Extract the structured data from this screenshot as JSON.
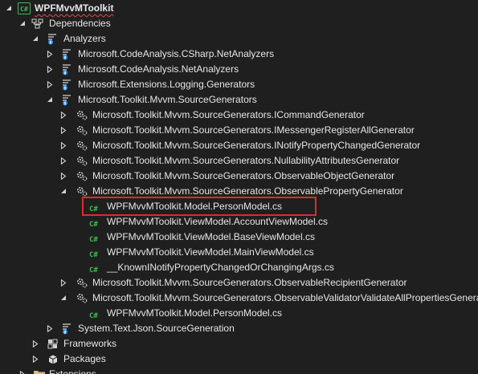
{
  "tree": [
    {
      "label": "WPFMvvMToolkit",
      "icon": "csharp-project-icon",
      "state": "expanded"
    },
    {
      "label": "Dependencies",
      "icon": "dependencies-icon",
      "state": "expanded"
    },
    {
      "label": "Analyzers",
      "icon": "analyzers-folder-icon",
      "state": "expanded"
    },
    {
      "label": "Microsoft.CodeAnalysis.CSharp.NetAnalyzers",
      "icon": "analyzer-package-icon",
      "state": "collapsed"
    },
    {
      "label": "Microsoft.CodeAnalysis.NetAnalyzers",
      "icon": "analyzer-package-icon",
      "state": "collapsed"
    },
    {
      "label": "Microsoft.Extensions.Logging.Generators",
      "icon": "analyzer-package-icon",
      "state": "collapsed"
    },
    {
      "label": "Microsoft.Toolkit.Mvvm.SourceGenerators",
      "icon": "analyzer-package-icon",
      "state": "expanded"
    },
    {
      "label": "Microsoft.Toolkit.Mvvm.SourceGenerators.ICommandGenerator",
      "icon": "source-generator-icon",
      "state": "collapsed"
    },
    {
      "label": "Microsoft.Toolkit.Mvvm.SourceGenerators.IMessengerRegisterAllGenerator",
      "icon": "source-generator-icon",
      "state": "collapsed"
    },
    {
      "label": "Microsoft.Toolkit.Mvvm.SourceGenerators.INotifyPropertyChangedGenerator",
      "icon": "source-generator-icon",
      "state": "collapsed"
    },
    {
      "label": "Microsoft.Toolkit.Mvvm.SourceGenerators.NullabilityAttributesGenerator",
      "icon": "source-generator-icon",
      "state": "collapsed"
    },
    {
      "label": "Microsoft.Toolkit.Mvvm.SourceGenerators.ObservableObjectGenerator",
      "icon": "source-generator-icon",
      "state": "collapsed"
    },
    {
      "label": "Microsoft.Toolkit.Mvvm.SourceGenerators.ObservablePropertyGenerator",
      "icon": "source-generator-icon",
      "state": "expanded"
    },
    {
      "label": "WPFMvvMToolkit.Model.PersonModel.cs",
      "icon": "csharp-file-icon",
      "state": "leaf",
      "selected": true
    },
    {
      "label": "WPFMvvMToolkit.ViewModel.AccountViewModel.cs",
      "icon": "csharp-file-icon",
      "state": "leaf"
    },
    {
      "label": "WPFMvvMToolkit.ViewModel.BaseViewModel.cs",
      "icon": "csharp-file-icon",
      "state": "leaf"
    },
    {
      "label": "WPFMvvMToolkit.ViewModel.MainViewModel.cs",
      "icon": "csharp-file-icon",
      "state": "leaf"
    },
    {
      "label": "__KnownINotifyPropertyChangedOrChangingArgs.cs",
      "icon": "csharp-file-icon",
      "state": "leaf"
    },
    {
      "label": "Microsoft.Toolkit.Mvvm.SourceGenerators.ObservableRecipientGenerator",
      "icon": "source-generator-icon",
      "state": "collapsed"
    },
    {
      "label": "Microsoft.Toolkit.Mvvm.SourceGenerators.ObservableValidatorValidateAllPropertiesGenerator",
      "icon": "source-generator-icon",
      "state": "expanded"
    },
    {
      "label": "WPFMvvMToolkit.Model.PersonModel.cs",
      "icon": "csharp-file-icon",
      "state": "leaf"
    },
    {
      "label": "System.Text.Json.SourceGeneration",
      "icon": "analyzer-package-icon",
      "state": "collapsed"
    },
    {
      "label": "Frameworks",
      "icon": "frameworks-icon",
      "state": "collapsed"
    },
    {
      "label": "Packages",
      "icon": "packages-icon",
      "state": "collapsed"
    },
    {
      "label": "Extensions",
      "icon": "folder-icon",
      "state": "collapsed"
    }
  ],
  "colors": {
    "background": "#1f1f1f",
    "text": "#e6e6e6",
    "csharp_green": "#3fb950",
    "highlight_border": "#e12a2a",
    "analyzer_blue": "#2f8fe8",
    "folder_yellow": "#dcb67a"
  },
  "icon_glyphs": {
    "csharp-file-icon": "C#"
  }
}
